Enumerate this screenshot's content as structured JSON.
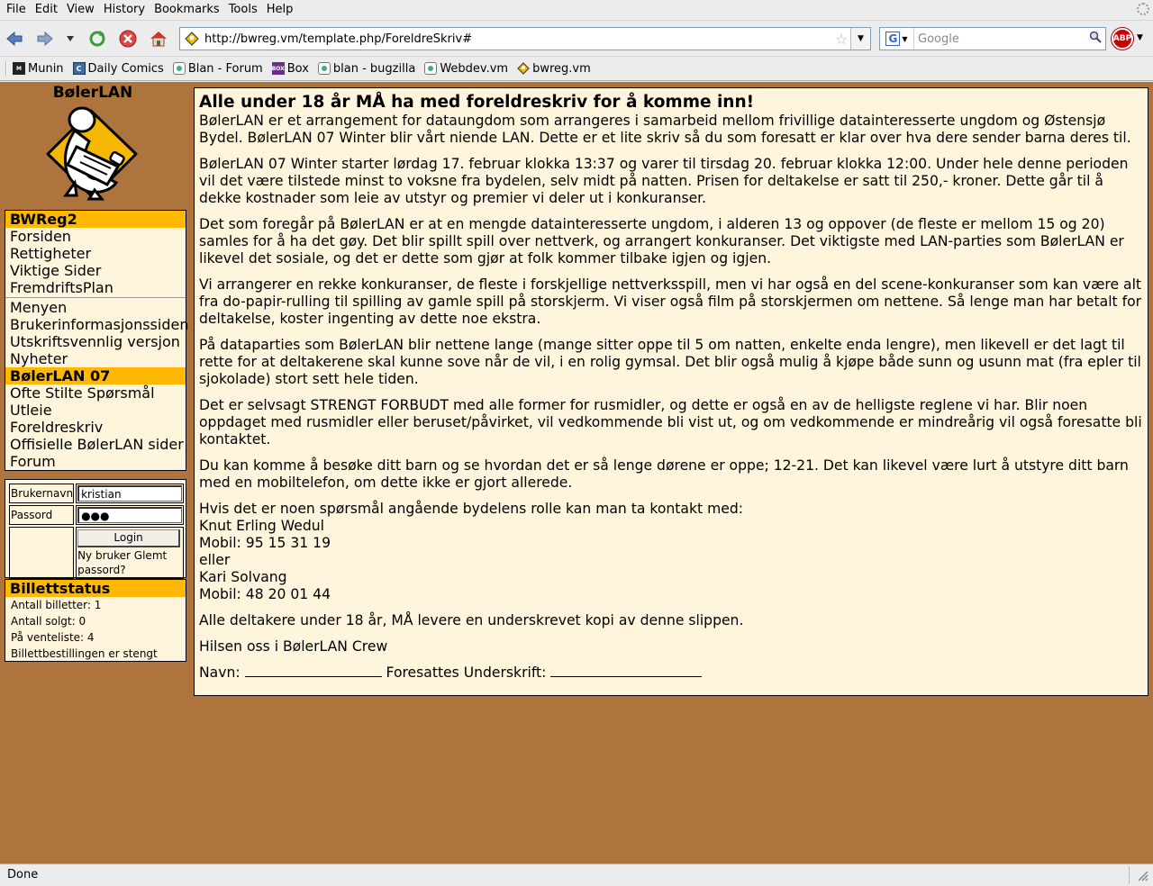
{
  "browser": {
    "menu": [
      "File",
      "Edit",
      "View",
      "History",
      "Bookmarks",
      "Tools",
      "Help"
    ],
    "url": "http://bwreg.vm/template.php/ForeldreSkriv#",
    "search_placeholder": "Google",
    "adblock_label": "ABP",
    "bookmarks": [
      {
        "label": "Munin",
        "icon": "munin-icon"
      },
      {
        "label": "Daily Comics",
        "icon": "comics-icon"
      },
      {
        "label": "Blan - Forum",
        "icon": "forum-icon"
      },
      {
        "label": "Box",
        "icon": "box-icon"
      },
      {
        "label": "blan - bugzilla",
        "icon": "bugzilla-icon"
      },
      {
        "label": "Webdev.vm",
        "icon": "webdev-icon"
      },
      {
        "label": "bwreg.vm",
        "icon": "bwreg-icon"
      }
    ],
    "status": "Done"
  },
  "sidebar": {
    "site_title": "BølerLAN",
    "section1_title": "BWReg2",
    "section1_items": [
      "Forsiden",
      "Rettigheter",
      "Viktige Sider",
      "FremdriftsPlan"
    ],
    "section2_items": [
      "Menyen",
      "Brukerinformasjonssiden",
      "Utskriftsvennlig versjon",
      "Nyheter"
    ],
    "section3_title": "BølerLAN 07",
    "section3_items": [
      "Ofte Stilte Spørsmål",
      "Utleie",
      "Foreldreskriv",
      "Offisielle BølerLAN sider",
      "Forum"
    ],
    "login": {
      "username_label": "Brukernavn",
      "username_value": "kristian",
      "password_label": "Passord",
      "password_mask": "●●●",
      "login_button": "Login",
      "new_user_link": "Ny bruker",
      "forgot_link": "Glemt passord?"
    },
    "tickets": {
      "title": "Billettstatus",
      "lines": [
        "Antall billetter: 1",
        "Antall solgt: 0",
        "På venteliste: 4",
        "Billettbestillingen er stengt"
      ]
    }
  },
  "content": {
    "heading": "Alle under 18 år MÅ ha med foreldreskriv for å komme inn!",
    "intro": "BølerLAN er et arrangement for dataungdom som arrangeres i samarbeid mellom frivillige datainteresserte ungdom og Østensjø Bydel. BølerLAN 07 Winter blir vårt niende LAN. Dette er et lite skriv så du som foresatt er klar over hva dere sender barna deres til.",
    "paragraphs": [
      "BølerLAN 07 Winter starter lørdag 17. februar klokka 13:37 og varer til tirsdag 20. februar klokka 12:00. Under hele denne perioden vil det være tilstede minst to voksne fra bydelen, selv midt på natten. Prisen for deltakelse er satt til 250,- kroner. Dette går til å dekke kostnader som leie av utstyr og premier vi deler ut i konkuranser.",
      "Det som foregår på BølerLAN er at en mengde datainteresserte ungdom, i alderen 13 og oppover (de fleste er mellom 15 og 20) samles for å ha det gøy. Det blir spillt spill over nettverk, og arrangert konkuranser. Det viktigste med LAN-parties som BølerLAN er likevel det sosiale, og det er dette som gjør at folk kommer tilbake igjen og igjen.",
      "Vi arrangerer en rekke konkuranser, de fleste i forskjellige nettverksspill, men vi har også en del scene-konkuranser som kan være alt fra do-papir-rulling til spilling av gamle spill på storskjerm. Vi viser også film på storskjermen om nettene. Så lenge man har betalt for deltakelse, koster ingenting av dette noe ekstra.",
      "På dataparties som BølerLAN blir nettene lange (mange sitter oppe til 5 om natten, enkelte enda lengre), men likevell er det lagt til rette for at deltakerene skal kunne sove når de vil, i en rolig gymsal. Det blir også mulig å kjøpe både sunn og usunn mat (fra epler til sjokolade) stort sett hele tiden.",
      "Det er selvsagt STRENGT FORBUDT med alle former for rusmidler, og dette er også en av de helligste reglene vi har. Blir noen oppdaget med rusmidler eller beruset/påvirket, vil vedkommende bli vist ut, og om vedkommende er mindreårig vil også foresatte bli kontaktet.",
      "Du kan komme å besøke ditt barn og se hvordan det er så lenge dørene er oppe; 12-21. Det kan likevel være lurt å utstyre ditt barn med en mobiltelefon, om dette ikke er gjort allerede."
    ],
    "contact_intro": "Hvis det er noen spørsmål angående bydelens rolle is kan man ta kontakt med:",
    "contact1_name": "Knut Erling Wedul",
    "contact1_phone": "Mobil: 95 15 31 19",
    "contact_or": "eller",
    "contact2_name": "Kari Solvang",
    "contact2_phone": "Mobil: 48 20 01 44",
    "slip_text": "Alle deltakere under 18 år, MÅ levere en underskrevet kopi av denne slippen.",
    "greeting": "Hilsen oss i BølerLAN Crew",
    "name_label": "Navn:",
    "signature_label": "Foresattes Underskrift:"
  }
}
